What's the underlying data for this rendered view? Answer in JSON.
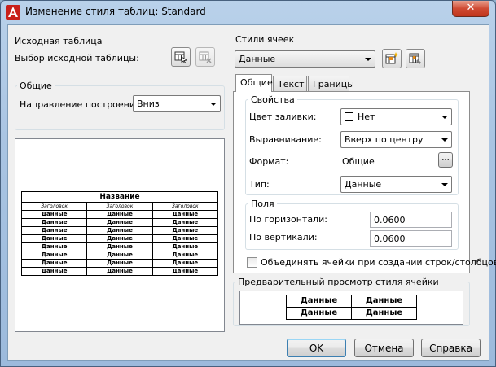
{
  "window": {
    "title": "Изменение стиля таблиц: Standard",
    "close_glyph": "✕"
  },
  "source_table": {
    "group_title": "Исходная таблица",
    "label": "Выбор исходной таблицы:"
  },
  "general": {
    "group_title": "Общие",
    "direction_label": "Направление построения:",
    "direction_value": "Вниз"
  },
  "table_preview": {
    "title": "Название",
    "header": "Заголовок",
    "cell": "Данные",
    "columns": 3,
    "rows": 8
  },
  "cell_styles": {
    "group_title": "Стили ячеек",
    "selected": "Данные"
  },
  "tabs": [
    {
      "label": "Общие",
      "active": true
    },
    {
      "label": "Текст",
      "active": false
    },
    {
      "label": "Границы",
      "active": false
    }
  ],
  "properties": {
    "group_title": "Свойства",
    "fill_label": "Цвет заливки:",
    "fill_value": "Нет",
    "align_label": "Выравнивание:",
    "align_value": "Вверх по центру",
    "format_label": "Формат:",
    "format_value": "Общие",
    "format_button": "...",
    "type_label": "Тип:",
    "type_value": "Данные"
  },
  "margins": {
    "group_title": "Поля",
    "horizontal_label": "По горизонтали:",
    "horizontal_value": "0.0600",
    "vertical_label": "По вертикали:",
    "vertical_value": "0.0600"
  },
  "merge_checkbox": {
    "label": "Объединять ячейки при создании строк/столбцов",
    "checked": false
  },
  "cell_style_preview": {
    "group_title": "Предварительный просмотр стиля ячейки",
    "cell": "Данные"
  },
  "buttons": {
    "ok": "OK",
    "cancel": "Отмена",
    "help": "Справка"
  }
}
